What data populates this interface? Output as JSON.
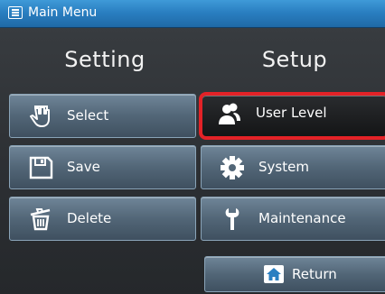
{
  "window": {
    "title": "Main Menu"
  },
  "columns": {
    "setting": "Setting",
    "setup": "Setup"
  },
  "setting_buttons": {
    "select": "Select",
    "save": "Save",
    "delete": "Delete"
  },
  "setup_buttons": {
    "user_level": "User Level",
    "system": "System",
    "maintenance": "Maintenance"
  },
  "footer": {
    "return": "Return"
  },
  "colors": {
    "title_bar": "#2a7fc1",
    "button": "#526677",
    "selected_border": "#e32227",
    "selected_fill": "#141516"
  },
  "icons": {
    "title": "menu-list-icon",
    "select": "hand-pointer-icon",
    "save": "floppy-disk-icon",
    "delete": "trash-can-icon",
    "user_level": "users-icon",
    "system": "gear-icon",
    "maintenance": "wrench-icon",
    "return": "home-icon"
  }
}
